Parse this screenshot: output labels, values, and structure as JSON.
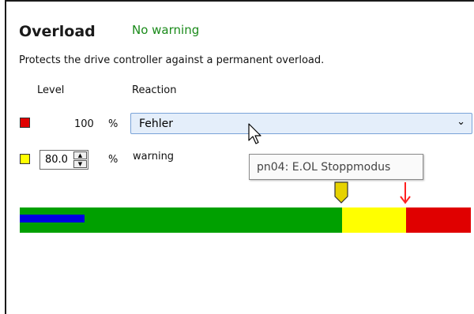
{
  "panel": {
    "title": "Overload",
    "status": "No warning",
    "description": "Protects the drive controller against a permanent overload."
  },
  "columns": {
    "level": "Level",
    "reaction": "Reaction"
  },
  "error_row": {
    "level_value": "100",
    "unit": "%",
    "reaction_value": "Fehler",
    "swatch_color": "#e00000"
  },
  "warning_row": {
    "level_value": "80.0",
    "unit": "%",
    "reaction_label": "warning",
    "swatch_color": "#ffff00"
  },
  "tooltip": {
    "text": "pn04: E.OL Stoppmodus"
  },
  "load_bar": {
    "current_load_percent": 16.8,
    "warning_threshold_percent": 80.0,
    "error_threshold_percent": 100,
    "colors": {
      "normal": "#00a000",
      "warning": "#ffff00",
      "error": "#e00000",
      "current": "#0000e0",
      "warning_marker": "#e6d200",
      "error_marker": "#ff2020"
    }
  }
}
